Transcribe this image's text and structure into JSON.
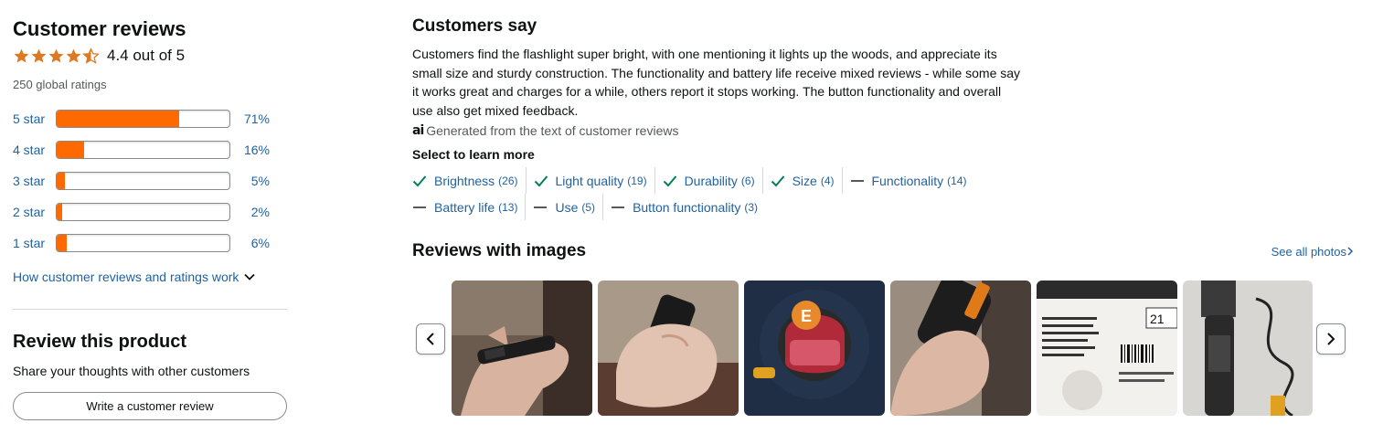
{
  "summary_panel": {
    "title": "Customer reviews",
    "rating_text": "4.4 out of 5",
    "rating_value": 4.4,
    "global_ratings": "250 global ratings",
    "histogram": [
      {
        "label": "5 star",
        "percent_text": "71%",
        "percent": 71
      },
      {
        "label": "4 star",
        "percent_text": "16%",
        "percent": 16
      },
      {
        "label": "3 star",
        "percent_text": "5%",
        "percent": 5
      },
      {
        "label": "2 star",
        "percent_text": "2%",
        "percent": 2
      },
      {
        "label": "1 star",
        "percent_text": "6%",
        "percent": 6
      }
    ],
    "how_link": "How customer reviews and ratings work",
    "review_title": "Review this product",
    "review_subtitle": "Share your thoughts with other customers",
    "write_button": "Write a customer review"
  },
  "customers_say": {
    "title": "Customers say",
    "summary": "Customers find the flashlight super bright, with one mentioning it lights up the woods, and appreciate its small size and sturdy construction. The functionality and battery life receive mixed reviews - while some say it works great and charges for a while, others report it stops working. The button functionality and overall use also get mixed feedback.",
    "generated_note": "Generated from the text of customer reviews",
    "ai_icon": "ai",
    "select_label": "Select to learn more",
    "aspects": [
      {
        "label": "Brightness",
        "count": "(26)",
        "icon": "check"
      },
      {
        "label": "Light quality",
        "count": "(19)",
        "icon": "check"
      },
      {
        "label": "Durability",
        "count": "(6)",
        "icon": "check"
      },
      {
        "label": "Size",
        "count": "(4)",
        "icon": "check"
      },
      {
        "label": "Functionality",
        "count": "(14)",
        "icon": "dash"
      },
      {
        "label": "Battery life",
        "count": "(13)",
        "icon": "dash"
      },
      {
        "label": "Use",
        "count": "(5)",
        "icon": "dash"
      },
      {
        "label": "Button functionality",
        "count": "(3)",
        "icon": "dash"
      }
    ]
  },
  "reviews_with_images": {
    "title": "Reviews with images",
    "see_all": "See all photos",
    "thumbnails": [
      "photo-flashlight-in-palm",
      "photo-flashlight-in-fist",
      "photo-flashlight-tail-cap",
      "photo-flashlight-held",
      "photo-product-box",
      "photo-flashlight-with-cable"
    ]
  },
  "colors": {
    "star": "#de7921",
    "bar_fill": "#ff6a00",
    "link": "#2162a1",
    "positive_icon": "#067d62"
  }
}
